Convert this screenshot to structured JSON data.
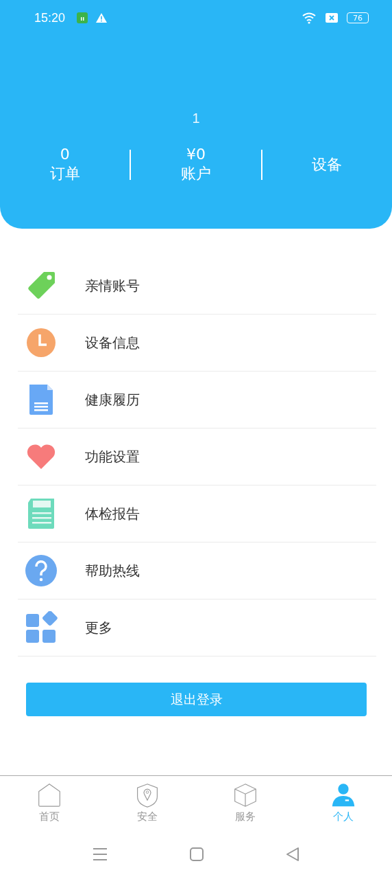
{
  "status_bar": {
    "time": "15:20",
    "battery": "76"
  },
  "header": {
    "name": "1",
    "stats": [
      {
        "value": "0",
        "label": "订单"
      },
      {
        "value": "¥0",
        "label": "账户"
      },
      {
        "label": "设备"
      }
    ]
  },
  "menu": [
    {
      "kind": "tag",
      "label": "亲情账号"
    },
    {
      "kind": "clock",
      "label": "设备信息"
    },
    {
      "kind": "document",
      "label": "健康履历"
    },
    {
      "kind": "heart",
      "label": "功能设置"
    },
    {
      "kind": "report",
      "label": "体检报告"
    },
    {
      "kind": "help",
      "label": "帮助热线"
    },
    {
      "kind": "grid",
      "label": "更多"
    }
  ],
  "logout_button": "退出登录",
  "tabs": [
    {
      "kind": "home",
      "label": "首页",
      "selected": false
    },
    {
      "kind": "shield",
      "label": "安全",
      "selected": false
    },
    {
      "kind": "box",
      "label": "服务",
      "selected": false
    },
    {
      "kind": "person",
      "label": "个人",
      "selected": true
    }
  ]
}
